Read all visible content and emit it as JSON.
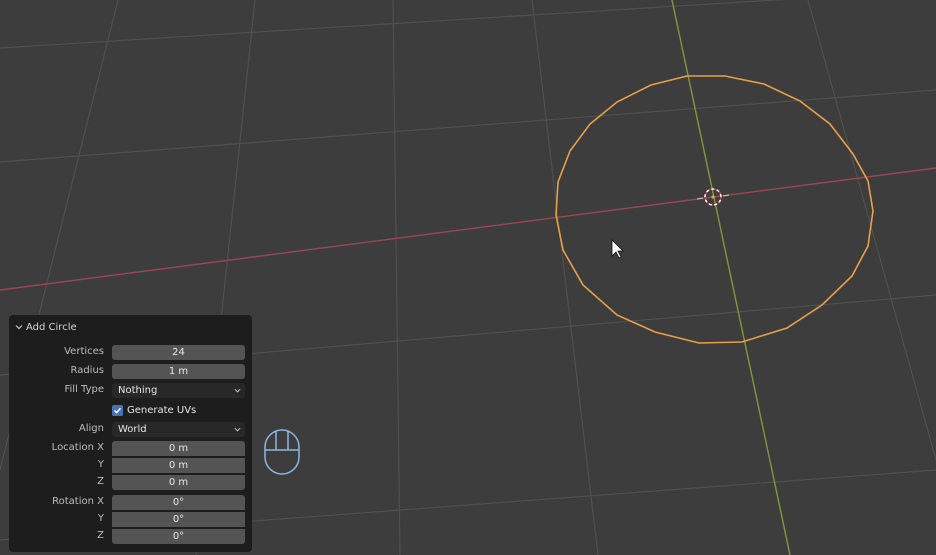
{
  "panel": {
    "title": "Add Circle",
    "vertices": {
      "label": "Vertices",
      "value": "24"
    },
    "radius": {
      "label": "Radius",
      "value": "1 m"
    },
    "fill_type": {
      "label": "Fill Type",
      "value": "Nothing"
    },
    "generate_uvs": {
      "label": "Generate UVs",
      "checked": true
    },
    "align": {
      "label": "Align",
      "value": "World"
    },
    "location": {
      "label_x": "Location X",
      "label_y": "Y",
      "label_z": "Z",
      "x": "0 m",
      "y": "0 m",
      "z": "0 m"
    },
    "rotation": {
      "label_x": "Rotation X",
      "label_y": "Y",
      "label_z": "Z",
      "x": "0°",
      "y": "0°",
      "z": "0°"
    }
  },
  "colors": {
    "viewport_bg": "#3d3d3d",
    "grid": "#4f4f4f",
    "x_axis": "#9b4752",
    "y_axis": "#7a9b3a",
    "selection": "#e8a04a",
    "accent": "#4772b3"
  },
  "icons": [
    "chevron-down-icon",
    "checkmark-icon",
    "mouse-icon",
    "cursor-icon",
    "3d-cursor-icon"
  ]
}
